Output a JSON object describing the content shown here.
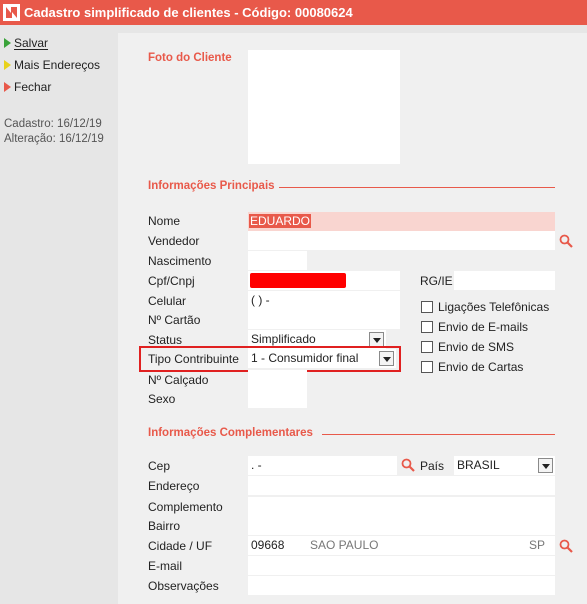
{
  "window": {
    "title": "Cadastro simplificado de clientes - Código: 00080624",
    "logo_icon": "app-logo-icon"
  },
  "sidebar": {
    "actions": [
      {
        "label": "Salvar",
        "icon": "arrow-green-icon"
      },
      {
        "label": "Mais Endereços",
        "icon": "arrow-yellow-icon"
      },
      {
        "label": "Fechar",
        "icon": "arrow-red-icon"
      }
    ],
    "cadastro": "Cadastro: 16/12/19",
    "alteracao": "Alteração: 16/12/19"
  },
  "foto": {
    "title": "Foto do Cliente"
  },
  "principais": {
    "title": "Informações Principais",
    "labels": {
      "nome": "Nome",
      "vendedor": "Vendedor",
      "nascimento": "Nascimento",
      "cpf": "Cpf/Cnpj",
      "celular": "Celular",
      "cartao": "Nº Cartão",
      "status": "Status",
      "tipo": "Tipo Contribuinte",
      "calcado": "Nº Calçado",
      "sexo": "Sexo",
      "rg": "RG/IE"
    },
    "values": {
      "nome": "EDUARDO",
      "vendedor": "",
      "nascimento": "",
      "cpf": "",
      "celular": "(   )     -",
      "cartao": "",
      "status": "Simplificado",
      "tipo": "1 - Consumidor final",
      "calcado": "",
      "sexo": "",
      "rg": ""
    },
    "checkboxes": [
      "Ligações Telefônicas",
      "Envio de E-mails",
      "Envio de SMS",
      "Envio de Cartas"
    ]
  },
  "complementares": {
    "title": "Informações Complementares",
    "labels": {
      "cep": "Cep",
      "pais": "País",
      "endereco": "Endereço",
      "complemento": "Complemento",
      "bairro": "Bairro",
      "cidade": "Cidade / UF",
      "email": "E-mail",
      "obs": "Observações"
    },
    "values": {
      "cep": "   .   -",
      "pais": "BRASIL",
      "endereco": "",
      "complemento": "",
      "bairro": "",
      "cidade_codigo": "09668",
      "cidade_nome": "SAO PAULO",
      "uf": "SP",
      "email": "",
      "obs": ""
    }
  },
  "colors": {
    "accent": "#e8594a",
    "highlight": "#e02020",
    "nome_bg": "#f9d5d0"
  }
}
